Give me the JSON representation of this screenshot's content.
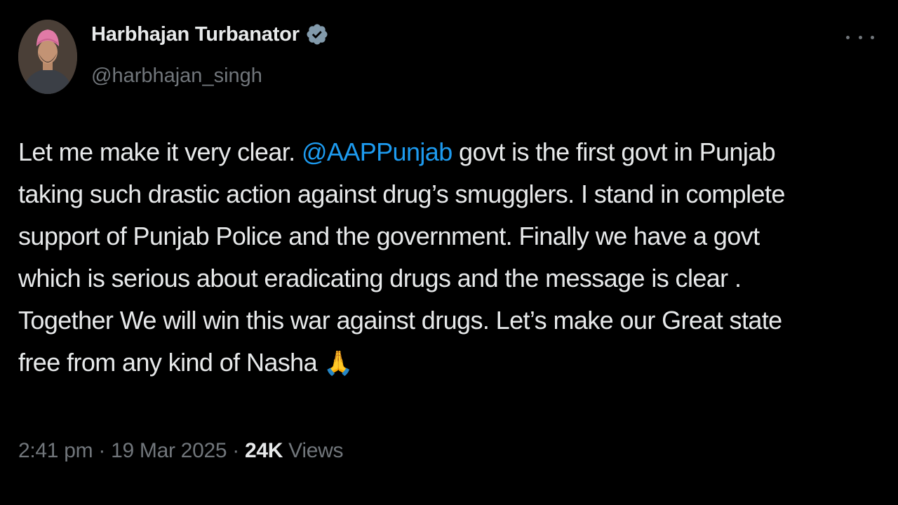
{
  "author": {
    "display_name": "Harbhajan Turbanator",
    "handle": "@harbhajan_singh",
    "verified": true,
    "avatar_icon": "profile-photo-avatar"
  },
  "tweet": {
    "lines": [
      {
        "before": "Let me make it very clear. ",
        "mention": "@AAPPunjab",
        "after": " govt is the first govt in Punjab"
      },
      {
        "text": "taking such drastic action against drug’s smugglers. I stand in complete"
      },
      {
        "text": "support of Punjab Police and the government. Finally we have a govt"
      },
      {
        "text": "which is serious about eradicating drugs and the message is clear ."
      },
      {
        "text": "Together We will win this war against drugs. Let’s make our Great state"
      },
      {
        "text": "free from any kind of Nasha ",
        "emoji": "🙏"
      }
    ]
  },
  "meta": {
    "time": "2:41 pm",
    "separator": " · ",
    "date": "19 Mar 2025",
    "views_count": "24K",
    "views_label": " Views"
  },
  "colors": {
    "background": "#000000",
    "text": "#e7e9ea",
    "secondary": "#71767b",
    "mention": "#1d9bf0",
    "verified_badge": "#829aab"
  },
  "icons": {
    "verified": "verified-badge-icon",
    "more": "more-options-icon"
  }
}
